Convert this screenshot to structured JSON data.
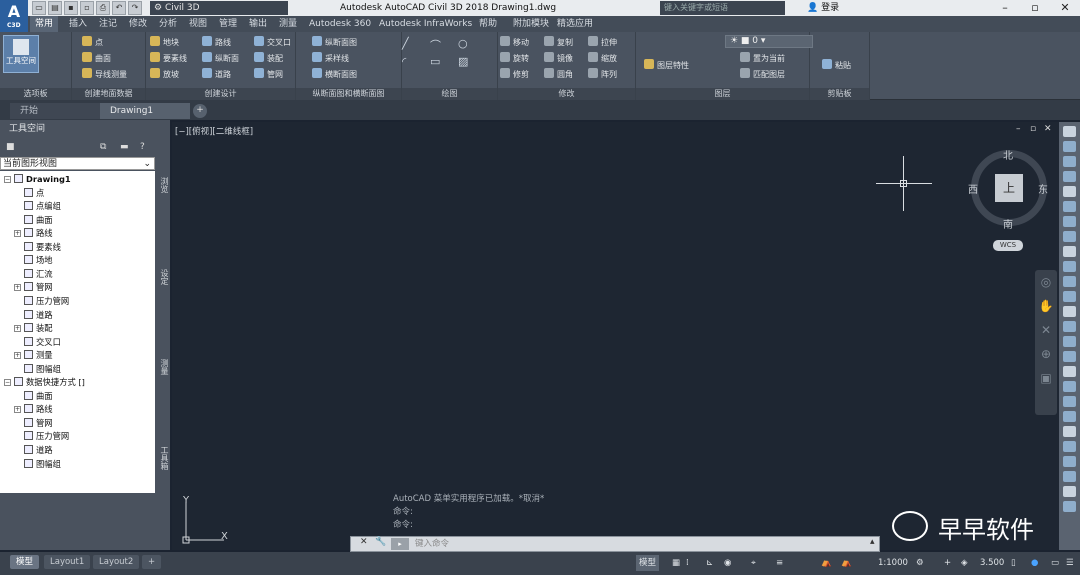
{
  "titlebar": {
    "app_letter": "A",
    "app_sub": "C3D",
    "workspace": "Civil 3D",
    "title": "Autodesk AutoCAD Civil 3D 2018   Drawing1.dwg",
    "search_placeholder": "键入关键字或短语",
    "login": "登录"
  },
  "menu_tabs": [
    "常用",
    "插入",
    "注记",
    "修改",
    "分析",
    "视图",
    "管理",
    "输出",
    "测量",
    "Autodesk 360",
    "Autodesk InfraWorks",
    "帮助",
    "附加模块",
    "精选应用"
  ],
  "ribbon": {
    "workspace_tool": "工具空间",
    "panels": [
      "选项板",
      "创建地面数据",
      "创建设计",
      "纵断面图和横断面图",
      "绘图",
      "修改",
      "图层",
      "剪贴板"
    ],
    "create_ground": [
      "点",
      "曲面",
      "导线测量"
    ],
    "create_design": [
      "地块",
      "要素线",
      "放坡",
      "路线",
      "纵断面",
      "道路",
      "交叉口",
      "装配",
      "管网"
    ],
    "profile": [
      "纵断面图",
      "采样线",
      "横断面图"
    ],
    "modify": [
      "移动",
      "旋转",
      "修剪",
      "复制",
      "镜像",
      "圆角",
      "拉伸",
      "缩放",
      "阵列"
    ],
    "layer_value": "0",
    "layer_props": "图层特性",
    "set_current": "置为当前",
    "match_layer": "匹配图层",
    "paste": "粘贴"
  },
  "doc_tabs": [
    "开始",
    "Drawing1"
  ],
  "toolspace": {
    "title": "工具空间",
    "view": "当前图形视图",
    "tree": [
      {
        "label": "Drawing1",
        "level": 0,
        "bold": true
      },
      {
        "label": "点",
        "level": 1
      },
      {
        "label": "点编组",
        "level": 1
      },
      {
        "label": "曲面",
        "level": 1
      },
      {
        "label": "路线",
        "level": 1
      },
      {
        "label": "要素线",
        "level": 1
      },
      {
        "label": "场地",
        "level": 1
      },
      {
        "label": "汇流",
        "level": 1
      },
      {
        "label": "管网",
        "level": 1
      },
      {
        "label": "压力管网",
        "level": 1
      },
      {
        "label": "道路",
        "level": 1
      },
      {
        "label": "装配",
        "level": 1
      },
      {
        "label": "交叉口",
        "level": 1
      },
      {
        "label": "测量",
        "level": 1
      },
      {
        "label": "图幅组",
        "level": 1
      },
      {
        "label": "数据快捷方式 []",
        "level": 0
      },
      {
        "label": "曲面",
        "level": 1
      },
      {
        "label": "路线",
        "level": 1
      },
      {
        "label": "管网",
        "level": 1
      },
      {
        "label": "压力管网",
        "level": 1
      },
      {
        "label": "道路",
        "level": 1
      },
      {
        "label": "图幅组",
        "level": 1
      }
    ],
    "side_tabs": [
      "浏览",
      "设定",
      "测量",
      "工具箱"
    ]
  },
  "viewport": {
    "label": "[−][俯视][二维线框]",
    "compass": {
      "north": "北",
      "south": "南",
      "east": "东",
      "west": "西",
      "top": "上"
    },
    "wcs": "WCS",
    "axis_x": "X",
    "axis_y": "Y"
  },
  "command": {
    "history": [
      "AutoCAD 菜单实用程序已加载。*取消*",
      "命令:",
      "命令:"
    ],
    "placeholder": "键入命令"
  },
  "watermark": "早早软件",
  "layout_tabs": [
    "模型",
    "Layout1",
    "Layout2"
  ],
  "statusbar": {
    "model": "模型",
    "scale": "1:1000",
    "value": "3.500"
  }
}
